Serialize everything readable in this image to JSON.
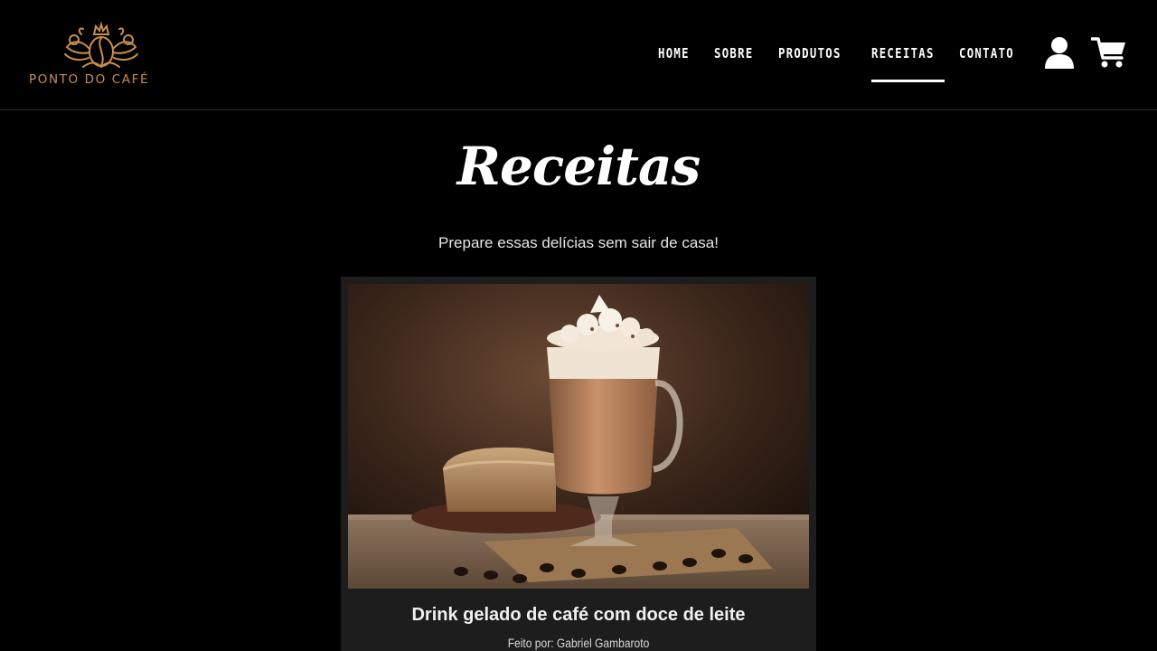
{
  "brand": {
    "name": "PONTO DO CAFÉ",
    "color": "#c98d4f"
  },
  "nav": {
    "items": [
      {
        "label": "HOME"
      },
      {
        "label": "SOBRE"
      },
      {
        "label": "PRODUTOS"
      },
      {
        "label": "RECEITAS",
        "active": true
      },
      {
        "label": "CONTATO"
      }
    ]
  },
  "icons": {
    "user": "user-icon",
    "cart": "cart-icon"
  },
  "page": {
    "title": "Receitas",
    "subtitle": "Prepare essas delícias sem sair de casa!"
  },
  "recipes": [
    {
      "title": "Drink gelado de café com doce de leite",
      "author": "Feito por: Gabriel Gambaroto",
      "image": "iced-coffee-drink-photo"
    }
  ]
}
